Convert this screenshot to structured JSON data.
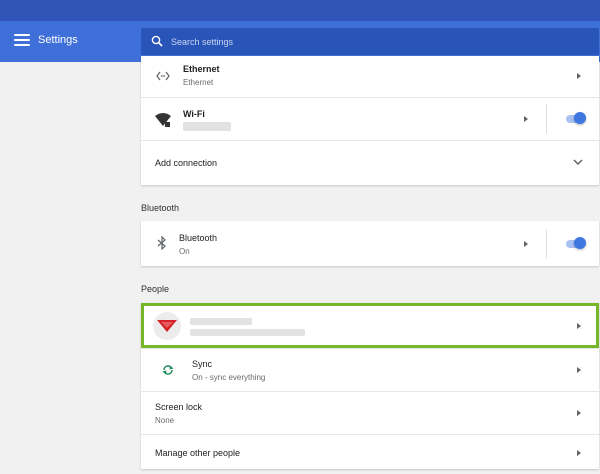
{
  "header": {
    "title": "Settings",
    "search_placeholder": "Search settings"
  },
  "network": {
    "ethernet": {
      "title": "Ethernet",
      "subtitle": "Ethernet"
    },
    "wifi": {
      "title": "Wi-Fi",
      "enabled": true
    },
    "add_connection": "Add connection"
  },
  "bluetooth": {
    "section_title": "Bluetooth",
    "row": {
      "title": "Bluetooth",
      "subtitle": "On",
      "enabled": true
    }
  },
  "people": {
    "section_title": "People",
    "sync": {
      "title": "Sync",
      "subtitle": "On - sync everything"
    },
    "screen_lock": {
      "title": "Screen lock",
      "subtitle": "None"
    },
    "manage_other": "Manage other people"
  },
  "colors": {
    "accent": "#3f6fd9",
    "toggle": "#3f77e0",
    "highlight": "#76b72a"
  }
}
